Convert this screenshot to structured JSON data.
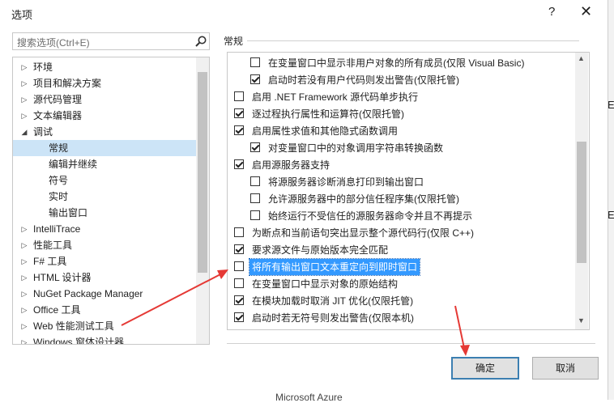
{
  "window": {
    "title": "选项",
    "help_label": "?",
    "close_label": "✕",
    "background_edge_texts": [
      "E",
      "E"
    ]
  },
  "search": {
    "placeholder": "搜索选项(Ctrl+E)"
  },
  "tree": {
    "items": [
      {
        "label": "环境",
        "arrow": "▷",
        "level": 0
      },
      {
        "label": "项目和解决方案",
        "arrow": "▷",
        "level": 0
      },
      {
        "label": "源代码管理",
        "arrow": "▷",
        "level": 0
      },
      {
        "label": "文本编辑器",
        "arrow": "▷",
        "level": 0
      },
      {
        "label": "调试",
        "arrow": "◢",
        "level": 0
      },
      {
        "label": "常规",
        "arrow": "",
        "level": 1,
        "selected": true
      },
      {
        "label": "编辑并继续",
        "arrow": "",
        "level": 1
      },
      {
        "label": "符号",
        "arrow": "",
        "level": 1
      },
      {
        "label": "实时",
        "arrow": "",
        "level": 1
      },
      {
        "label": "输出窗口",
        "arrow": "",
        "level": 1
      },
      {
        "label": "IntelliTrace",
        "arrow": "▷",
        "level": 0
      },
      {
        "label": "性能工具",
        "arrow": "▷",
        "level": 0
      },
      {
        "label": "F# 工具",
        "arrow": "▷",
        "level": 0
      },
      {
        "label": "HTML 设计器",
        "arrow": "▷",
        "level": 0
      },
      {
        "label": "NuGet Package Manager",
        "arrow": "▷",
        "level": 0
      },
      {
        "label": "Office 工具",
        "arrow": "▷",
        "level": 0
      },
      {
        "label": "Web 性能测试工具",
        "arrow": "▷",
        "level": 0
      },
      {
        "label": "Windows 窗体设计器",
        "arrow": "▷",
        "level": 0
      }
    ]
  },
  "section": {
    "title": "常规"
  },
  "options": [
    {
      "label": "在变量窗口中显示非用户对象的所有成员(仅限 Visual Basic)",
      "checked": false,
      "indent": 1
    },
    {
      "label": "启动时若没有用户代码则发出警告(仅限托管)",
      "checked": true,
      "indent": 1
    },
    {
      "label": "启用 .NET Framework 源代码单步执行",
      "checked": false,
      "indent": 0
    },
    {
      "label": "逐过程执行属性和运算符(仅限托管)",
      "checked": true,
      "indent": 0
    },
    {
      "label": "启用属性求值和其他隐式函数调用",
      "checked": true,
      "indent": 0
    },
    {
      "label": "对变量窗口中的对象调用字符串转换函数",
      "checked": true,
      "indent": 1
    },
    {
      "label": "启用源服务器支持",
      "checked": true,
      "indent": 0
    },
    {
      "label": "将源服务器诊断消息打印到输出窗口",
      "checked": false,
      "indent": 1
    },
    {
      "label": "允许源服务器中的部分信任程序集(仅限托管)",
      "checked": false,
      "indent": 1
    },
    {
      "label": "始终运行不受信任的源服务器命令并且不再提示",
      "checked": false,
      "indent": 1
    },
    {
      "label": "为断点和当前语句突出显示整个源代码行(仅限 C++)",
      "checked": false,
      "indent": 0
    },
    {
      "label": "要求源文件与原始版本完全匹配",
      "checked": true,
      "indent": 0
    },
    {
      "label": "将所有输出窗口文本重定向到即时窗口",
      "checked": false,
      "indent": 0,
      "highlighted": true
    },
    {
      "label": "在变量窗口中显示对象的原始结构",
      "checked": false,
      "indent": 0
    },
    {
      "label": "在模块加载时取消 JIT 优化(仅限托管)",
      "checked": true,
      "indent": 0
    },
    {
      "label": "启动时若无符号则发出警告(仅限本机)",
      "checked": true,
      "indent": 0
    }
  ],
  "buttons": {
    "ok": "确定",
    "cancel": "取消"
  },
  "bottom_cut_text": "Microsoft Azure",
  "colors": {
    "selection": "#cce4f7",
    "highlight": "#3399ff",
    "annotation_arrow": "#e53935"
  }
}
